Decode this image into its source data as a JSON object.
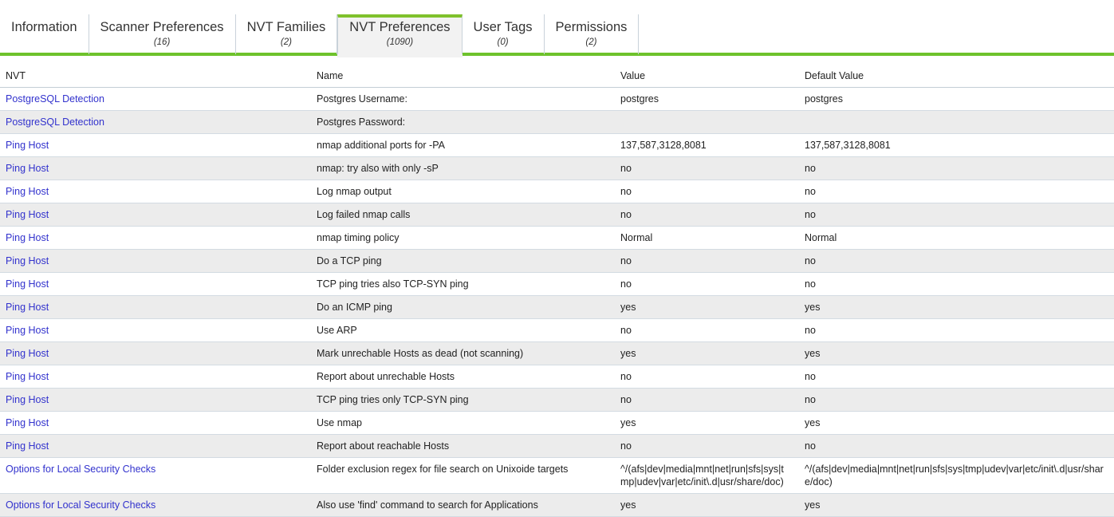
{
  "tabs": [
    {
      "label": "Information",
      "count": "",
      "active": false
    },
    {
      "label": "Scanner Preferences",
      "count": "(16)",
      "active": false
    },
    {
      "label": "NVT Families",
      "count": "(2)",
      "active": false
    },
    {
      "label": "NVT Preferences",
      "count": "(1090)",
      "active": true
    },
    {
      "label": "User Tags",
      "count": "(0)",
      "active": false
    },
    {
      "label": "Permissions",
      "count": "(2)",
      "active": false
    }
  ],
  "colors": {
    "accent_green": "#6ec22c",
    "tab_top_green": "#7fc12c",
    "link_blue": "#3232cd",
    "row_stripe": "#ececec",
    "active_tab_bg": "#f2f2f2"
  },
  "table": {
    "columns": [
      "NVT",
      "Name",
      "Value",
      "Default Value"
    ],
    "rows": [
      {
        "nvt": "PostgreSQL Detection",
        "name": "Postgres Username:",
        "value": "postgres",
        "default": "postgres"
      },
      {
        "nvt": "PostgreSQL Detection",
        "name": "Postgres Password:",
        "value": "",
        "default": ""
      },
      {
        "nvt": "Ping Host",
        "name": "nmap additional ports for -PA",
        "value": "137,587,3128,8081",
        "default": "137,587,3128,8081"
      },
      {
        "nvt": "Ping Host",
        "name": "nmap: try also with only -sP",
        "value": "no",
        "default": "no"
      },
      {
        "nvt": "Ping Host",
        "name": "Log nmap output",
        "value": "no",
        "default": "no"
      },
      {
        "nvt": "Ping Host",
        "name": "Log failed nmap calls",
        "value": "no",
        "default": "no"
      },
      {
        "nvt": "Ping Host",
        "name": "nmap timing policy",
        "value": "Normal",
        "default": "Normal"
      },
      {
        "nvt": "Ping Host",
        "name": "Do a TCP ping",
        "value": "no",
        "default": "no"
      },
      {
        "nvt": "Ping Host",
        "name": "TCP ping tries also TCP-SYN ping",
        "value": "no",
        "default": "no"
      },
      {
        "nvt": "Ping Host",
        "name": "Do an ICMP ping",
        "value": "yes",
        "default": "yes"
      },
      {
        "nvt": "Ping Host",
        "name": "Use ARP",
        "value": "no",
        "default": "no"
      },
      {
        "nvt": "Ping Host",
        "name": "Mark unrechable Hosts as dead (not scanning)",
        "value": "yes",
        "default": "yes"
      },
      {
        "nvt": "Ping Host",
        "name": "Report about unrechable Hosts",
        "value": "no",
        "default": "no"
      },
      {
        "nvt": "Ping Host",
        "name": "TCP ping tries only TCP-SYN ping",
        "value": "no",
        "default": "no"
      },
      {
        "nvt": "Ping Host",
        "name": "Use nmap",
        "value": "yes",
        "default": "yes"
      },
      {
        "nvt": "Ping Host",
        "name": "Report about reachable Hosts",
        "value": "no",
        "default": "no"
      },
      {
        "nvt": "Options for Local Security Checks",
        "name": "Folder exclusion regex for file search on Unixoide targets",
        "value": "^/(afs|dev|media|mnt|net|run|sfs|sys|tmp|udev|var|etc/init\\.d|usr/share/doc)",
        "default": "^/(afs|dev|media|mnt|net|run|sfs|sys|tmp|udev|var|etc/init\\.d|usr/share/doc)"
      },
      {
        "nvt": "Options for Local Security Checks",
        "name": "Also use 'find' command to search for Applications",
        "value": "yes",
        "default": "yes"
      }
    ]
  }
}
